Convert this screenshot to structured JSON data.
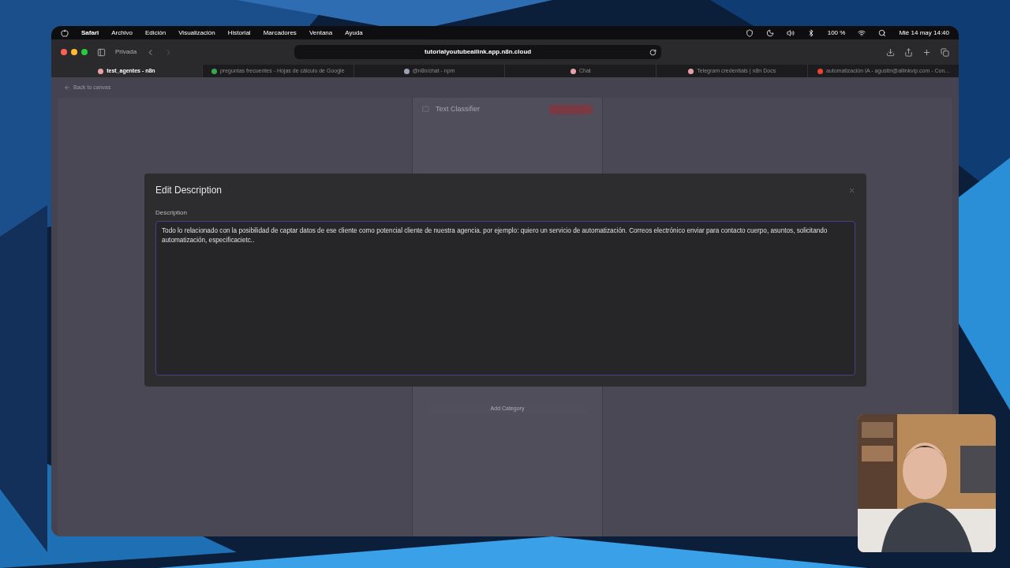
{
  "menu_bar": {
    "app": "Safari",
    "items": [
      "Archivo",
      "Edición",
      "Visualización",
      "Historial",
      "Marcadores",
      "Ventana",
      "Ayuda"
    ],
    "battery": "100 %",
    "clock": "Mié 14 may 14:40"
  },
  "window": {
    "profile": "Privada",
    "address": "tutorialyoutubeailink.app.n8n.cloud"
  },
  "tabs": [
    {
      "label": "test_agentes - n8n",
      "selected": true,
      "color": "#e8a0a8"
    },
    {
      "label": "preguntas frecuentes - Hojas de cálculo de Google",
      "selected": false,
      "color": "#34a853"
    },
    {
      "label": "@n8n/chat - npm",
      "selected": false,
      "color": "#9ca3af"
    },
    {
      "label": "Chat",
      "selected": false,
      "color": "#e8a0a8"
    },
    {
      "label": "Telegram credentials | n8n Docs",
      "selected": false,
      "color": "#e8a0a8"
    },
    {
      "label": "automatización IA - agustin@allinkvip.com - Con...",
      "selected": false,
      "color": "#ea4335"
    }
  ],
  "background_app": {
    "back_link": "Back to canvas",
    "node_title": "Text Classifier",
    "add_button": "Add Category"
  },
  "dialog": {
    "title": "Edit Description",
    "field_label": "Description",
    "value": "Todo lo relacionado con la posibilidad de captar datos de ese cliente como potencial cliente de nuestra agencia. por ejemplo: quiero un servicio de automatización.  Correos electrónico enviar para contacto cuerpo, asuntos, solicitando automatización, especificacietc.."
  }
}
